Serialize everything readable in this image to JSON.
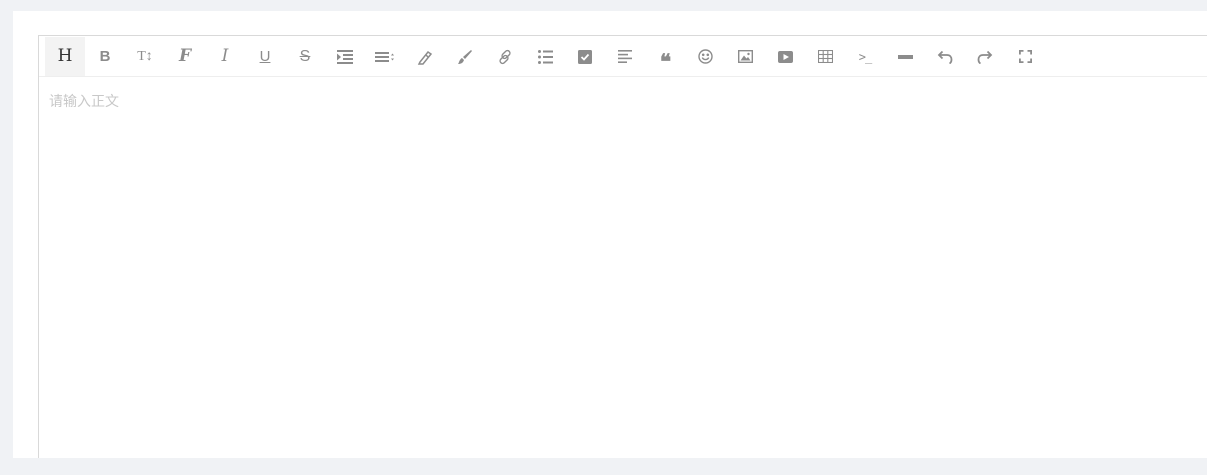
{
  "editor": {
    "placeholder": "请输入正文",
    "toolbar": [
      {
        "icon": "heading-icon",
        "glyph": "H",
        "active": true
      },
      {
        "icon": "bold-icon",
        "glyph": "B"
      },
      {
        "icon": "font-size-icon",
        "glyph": "T↕"
      },
      {
        "icon": "font-family-icon",
        "glyph": "F"
      },
      {
        "icon": "italic-icon",
        "glyph": "I"
      },
      {
        "icon": "underline-icon",
        "glyph": "U"
      },
      {
        "icon": "strikethrough-icon",
        "glyph": "S"
      },
      {
        "icon": "indent-icon"
      },
      {
        "icon": "line-height-icon"
      },
      {
        "icon": "font-color-icon"
      },
      {
        "icon": "background-color-icon"
      },
      {
        "icon": "link-icon"
      },
      {
        "icon": "list-icon"
      },
      {
        "icon": "todo-checkbox-icon"
      },
      {
        "icon": "justify-icon"
      },
      {
        "icon": "quote-icon",
        "glyph": "❝"
      },
      {
        "icon": "emoticon-icon"
      },
      {
        "icon": "image-icon"
      },
      {
        "icon": "video-icon"
      },
      {
        "icon": "table-icon"
      },
      {
        "icon": "code-icon",
        "glyph": ">_"
      },
      {
        "icon": "divider-icon"
      },
      {
        "icon": "undo-icon"
      },
      {
        "icon": "redo-icon"
      },
      {
        "icon": "fullscreen-icon"
      }
    ]
  }
}
